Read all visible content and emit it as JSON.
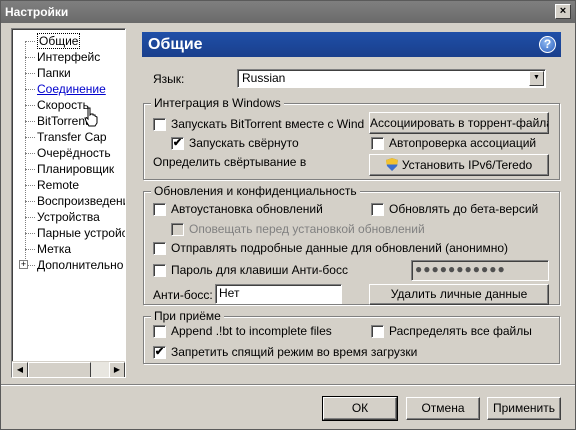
{
  "window": {
    "title": "Настройки",
    "close_glyph": "×"
  },
  "tree": {
    "items": [
      {
        "label": "Общие",
        "state": "selected"
      },
      {
        "label": "Интерфейс"
      },
      {
        "label": "Папки"
      },
      {
        "label": "Соединение",
        "state": "hover-link"
      },
      {
        "label": "Скорость"
      },
      {
        "label": "BitTorrent"
      },
      {
        "label": "Transfer Cap"
      },
      {
        "label": "Очерёдность"
      },
      {
        "label": "Планировщик"
      },
      {
        "label": "Remote"
      },
      {
        "label": "Воспроизведение"
      },
      {
        "label": "Устройства"
      },
      {
        "label": "Парные устройства"
      },
      {
        "label": "Метка"
      },
      {
        "label": "Дополнительно",
        "expandable": true
      }
    ],
    "expander_glyph": "+"
  },
  "page": {
    "title": "Общие",
    "help_glyph": "?",
    "language_label": "Язык:",
    "language_value": "Russian"
  },
  "integration": {
    "title": "Интеграция в Windows",
    "start_with_windows": {
      "label": "Запускать BitTorrent вместе с Wind",
      "checked": false
    },
    "start_minimized": {
      "label": "Запускать свёрнуто",
      "checked": true
    },
    "detect_minimize_label": "Определить свёртывание в",
    "associate_button": "Ассоциировать в торрент-файлами",
    "auto_check_assoc": {
      "label": "Автопроверка ассоциаций",
      "checked": false
    },
    "ipv6_button": "Установить IPv6/Teredo"
  },
  "privacy": {
    "title": "Обновления и конфиденциальность",
    "auto_update": {
      "label": "Автоустановка обновлений",
      "checked": false
    },
    "beta_updates": {
      "label": "Обновлять до бета-версий",
      "checked": false
    },
    "notify_before": {
      "label": "Оповещать перед установкой обновлений",
      "checked": false,
      "disabled": true
    },
    "send_data": {
      "label": "Отправлять подробные данные для обновлений (анонимно)",
      "checked": false
    },
    "boss_password": {
      "label": "Пароль для клавиши Анти-босс",
      "checked": false
    },
    "password_value": "●●●●●●●●●●●",
    "anti_boss_label": "Анти-босс:",
    "anti_boss_value": "Нет",
    "delete_button": "Удалить личные данные"
  },
  "on_add": {
    "title": "При приёме",
    "append_bt": {
      "label": "Append .!bt to incomplete files",
      "checked": false
    },
    "allocate_all": {
      "label": "Распределять все файлы",
      "checked": false
    },
    "prevent_sleep": {
      "label": "Запретить спящий режим во время загрузки",
      "checked": true
    }
  },
  "footer": {
    "ok": "ОК",
    "cancel": "Отмена",
    "apply": "Применить"
  },
  "check_glyph": "✔"
}
